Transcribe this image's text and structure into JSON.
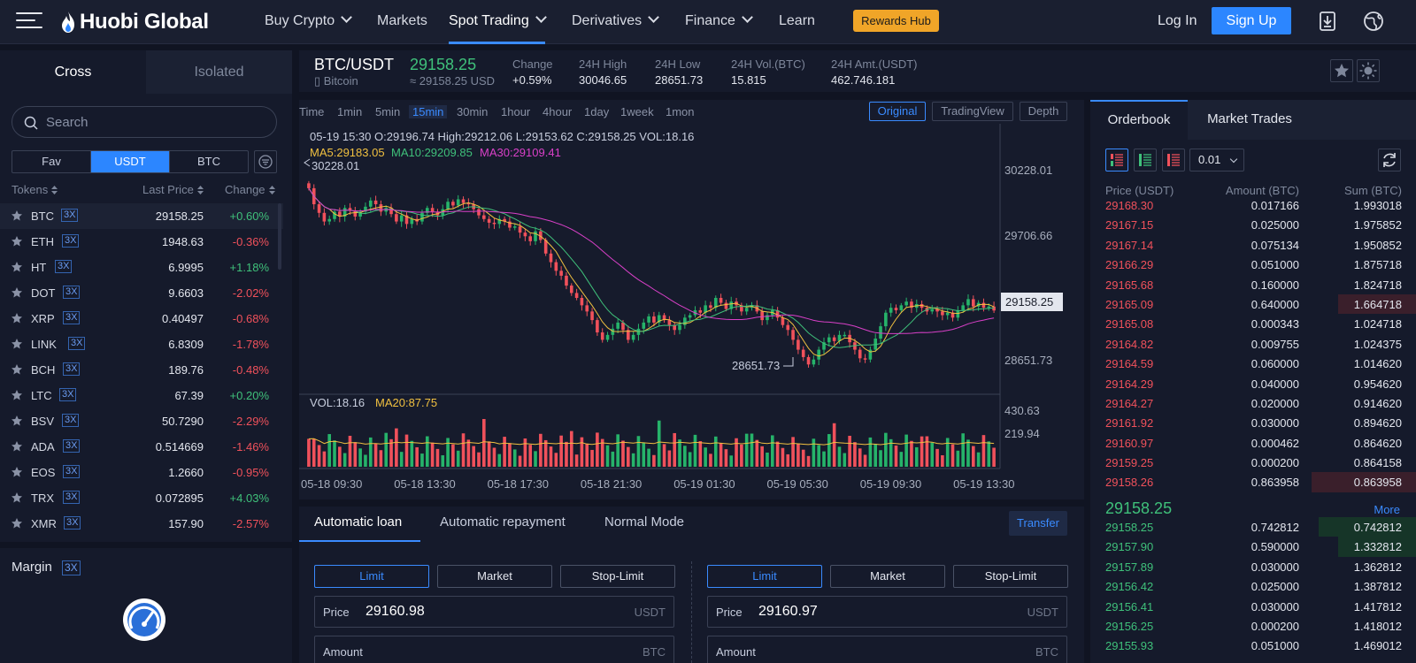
{
  "nav": {
    "logo": "Huobi Global",
    "items": [
      {
        "label": "Buy Crypto",
        "dropdown": true
      },
      {
        "label": "Markets",
        "dropdown": false
      },
      {
        "label": "Spot Trading",
        "dropdown": true,
        "active": true
      },
      {
        "label": "Derivatives",
        "dropdown": true
      },
      {
        "label": "Finance",
        "dropdown": true
      },
      {
        "label": "Learn",
        "dropdown": false
      }
    ],
    "rewards": "Rewards Hub",
    "login": "Log In",
    "signup": "Sign Up",
    "icons": [
      "download-icon",
      "globe-icon"
    ]
  },
  "left": {
    "tabs": [
      "Cross",
      "Isolated"
    ],
    "search_placeholder": "Search",
    "quote_tabs": [
      "Fav",
      "USDT",
      "BTC"
    ],
    "quote_active": "USDT",
    "headers": {
      "tokens": "Tokens",
      "last_price": "Last Price",
      "change": "Change"
    },
    "tokens": [
      {
        "sym": "BTC",
        "lev": "3X",
        "price": "29158.25",
        "chg": "+0.60%",
        "dir": "up"
      },
      {
        "sym": "ETH",
        "lev": "3X",
        "price": "1948.63",
        "chg": "-0.36%",
        "dir": "down"
      },
      {
        "sym": "HT",
        "lev": "3X",
        "price": "6.9995",
        "chg": "+1.18%",
        "dir": "up"
      },
      {
        "sym": "DOT",
        "lev": "3X",
        "price": "9.6603",
        "chg": "-2.02%",
        "dir": "down"
      },
      {
        "sym": "XRP",
        "lev": "3X",
        "price": "0.40497",
        "chg": "-0.68%",
        "dir": "down"
      },
      {
        "sym": "LINK",
        "lev": "3X",
        "price": "6.8309",
        "chg": "-1.78%",
        "dir": "down"
      },
      {
        "sym": "BCH",
        "lev": "3X",
        "price": "189.76",
        "chg": "-0.48%",
        "dir": "down"
      },
      {
        "sym": "LTC",
        "lev": "3X",
        "price": "67.39",
        "chg": "+0.20%",
        "dir": "up"
      },
      {
        "sym": "BSV",
        "lev": "3X",
        "price": "50.7290",
        "chg": "-2.29%",
        "dir": "down"
      },
      {
        "sym": "ADA",
        "lev": "3X",
        "price": "0.514669",
        "chg": "-1.46%",
        "dir": "down"
      },
      {
        "sym": "EOS",
        "lev": "3X",
        "price": "1.2660",
        "chg": "-0.95%",
        "dir": "down"
      },
      {
        "sym": "TRX",
        "lev": "3X",
        "price": "0.072895",
        "chg": "+4.03%",
        "dir": "up"
      },
      {
        "sym": "XMR",
        "lev": "3X",
        "price": "157.90",
        "chg": "-2.57%",
        "dir": "down"
      }
    ],
    "margin_label": "Margin",
    "margin_lev": "3X"
  },
  "ticker": {
    "pair": "BTC/USDT",
    "name": "Bitcoin",
    "last": "29158.25",
    "last_usd": "≈ 29158.25 USD",
    "stats": [
      {
        "label": "Change",
        "value": "+0.59%",
        "dir": "up"
      },
      {
        "label": "24H High",
        "value": "30046.65"
      },
      {
        "label": "24H Low",
        "value": "28651.73"
      },
      {
        "label": "24H Vol.(BTC)",
        "value": "15.815"
      },
      {
        "label": "24H Amt.(USDT)",
        "value": "462.746.181"
      }
    ]
  },
  "chart_toolbar": {
    "timeframes": [
      "Time",
      "1min",
      "5min",
      "15min",
      "30min",
      "1hour",
      "4hour",
      "1day",
      "1week",
      "1mon"
    ],
    "active": "15min",
    "views": [
      "Original",
      "TradingView",
      "Depth"
    ],
    "active_view": "Original"
  },
  "chart_data": {
    "type": "candlestick",
    "info_line": "05-19 15:30   O:29196.74  High:29212.06  L:29153.62  C:29158.25  VOL:18.16",
    "ma_labels": [
      {
        "text": "MA5:29183.05",
        "color": "#f0c040"
      },
      {
        "text": "MA10:29209.85",
        "color": "#3fc07a"
      },
      {
        "text": "MA30:29109.41",
        "color": "#d940c8"
      }
    ],
    "high_marker": "30228.01",
    "low_marker": "28651.73",
    "price_ticks": [
      "30228.01",
      "29706.66",
      "28651.73"
    ],
    "last_price_tag": "29158.25",
    "ylim": [
      28550,
      30300
    ],
    "vol_label": "VOL:18.16",
    "vol_ma_label": "MA20:87.75",
    "vol_ticks": [
      "430.63",
      "219.94"
    ],
    "x_labels": [
      "05-18 09:30",
      "05-18 13:30",
      "05-18 17:30",
      "05-18 21:30",
      "05-19 01:30",
      "05-19 05:30",
      "05-19 09:30",
      "05-19 13:30"
    ],
    "colors": {
      "up": "#26b36a",
      "down": "#f0515b",
      "ma5": "#f0c040",
      "ma10": "#3fc07a",
      "ma30": "#d940c8"
    },
    "closes": [
      30150,
      30020,
      29950,
      29880,
      29900,
      29960,
      29920,
      29990,
      29970,
      29920,
      29960,
      30000,
      30050,
      30020,
      29960,
      29990,
      29940,
      29880,
      29930,
      29860,
      29900,
      29880,
      29950,
      29990,
      29960,
      29930,
      29980,
      30040,
      30010,
      30060,
      30030,
      30020,
      29980,
      29930,
      29900,
      29870,
      29860,
      29900,
      29880,
      29830,
      29840,
      29790,
      29760,
      29720,
      29800,
      29730,
      29620,
      29550,
      29480,
      29440,
      29360,
      29300,
      29260,
      29200,
      29150,
      29080,
      28980,
      28920,
      28960,
      29010,
      29060,
      29000,
      28920,
      28960,
      29010,
      29060,
      29110,
      29060,
      29120,
      29080,
      29040,
      29000,
      29040,
      29100,
      29120,
      29160,
      29140,
      29200,
      29180,
      29260,
      29220,
      29170,
      29230,
      29200,
      29150,
      29180,
      29200,
      29150,
      29080,
      29120,
      29160,
      29100,
      29040,
      29000,
      28920,
      28840,
      28780,
      28720,
      28760,
      28840,
      28900,
      28940,
      28910,
      28960,
      28960,
      28900,
      28840,
      28770,
      28760,
      28840,
      28930,
      29030,
      29140,
      29180,
      29160,
      29200,
      29230,
      29180,
      29210,
      29180,
      29150,
      29170,
      29150,
      29120,
      29140,
      29100,
      29160,
      29200,
      29250,
      29190,
      29220,
      29180,
      29190,
      29158
    ]
  },
  "trade": {
    "tabs": [
      "Automatic loan",
      "Automatic repayment",
      "Normal Mode"
    ],
    "active": "Automatic loan",
    "transfer": "Transfer",
    "order_types": [
      "Limit",
      "Market",
      "Stop-Limit"
    ],
    "active_type": "Limit",
    "buy": {
      "price_label": "Price",
      "price": "29160.98",
      "price_unit": "USDT",
      "amount_label": "Amount",
      "amount_unit": "BTC"
    },
    "sell": {
      "price_label": "Price",
      "price": "29160.97",
      "price_unit": "USDT",
      "amount_label": "Amount",
      "amount_unit": "BTC"
    }
  },
  "orderbook": {
    "tabs": [
      "Orderbook",
      "Market Trades"
    ],
    "precision": "0.01",
    "headers": {
      "price": "Price (USDT)",
      "amount": "Amount (BTC)",
      "sum": "Sum (BTC)"
    },
    "asks": [
      {
        "p": "29168.30",
        "a": "0.017166",
        "s": "1.993018",
        "d": 0
      },
      {
        "p": "29167.15",
        "a": "0.025000",
        "s": "1.975852",
        "d": 0
      },
      {
        "p": "29167.14",
        "a": "0.075134",
        "s": "1.950852",
        "d": 0
      },
      {
        "p": "29166.29",
        "a": "0.051000",
        "s": "1.875718",
        "d": 0
      },
      {
        "p": "29165.68",
        "a": "0.160000",
        "s": "1.824718",
        "d": 0
      },
      {
        "p": "29165.09",
        "a": "0.640000",
        "s": "1.664718",
        "d": 0.24
      },
      {
        "p": "29165.08",
        "a": "0.000343",
        "s": "1.024718",
        "d": 0
      },
      {
        "p": "29164.82",
        "a": "0.009755",
        "s": "1.024375",
        "d": 0
      },
      {
        "p": "29164.59",
        "a": "0.060000",
        "s": "1.014620",
        "d": 0
      },
      {
        "p": "29164.29",
        "a": "0.040000",
        "s": "0.954620",
        "d": 0
      },
      {
        "p": "29164.27",
        "a": "0.020000",
        "s": "0.914620",
        "d": 0
      },
      {
        "p": "29161.92",
        "a": "0.030000",
        "s": "0.894620",
        "d": 0
      },
      {
        "p": "29160.97",
        "a": "0.000462",
        "s": "0.864620",
        "d": 0
      },
      {
        "p": "29159.25",
        "a": "0.000200",
        "s": "0.864158",
        "d": 0
      },
      {
        "p": "29158.26",
        "a": "0.863958",
        "s": "0.863958",
        "d": 0.32
      }
    ],
    "mid_price": "29158.25",
    "more": "More",
    "bids": [
      {
        "p": "29158.25",
        "a": "0.742812",
        "s": "0.742812",
        "d": 0.3
      },
      {
        "p": "29157.90",
        "a": "0.590000",
        "s": "1.332812",
        "d": 0.24
      },
      {
        "p": "29157.89",
        "a": "0.030000",
        "s": "1.362812",
        "d": 0
      },
      {
        "p": "29156.42",
        "a": "0.025000",
        "s": "1.387812",
        "d": 0
      },
      {
        "p": "29156.41",
        "a": "0.030000",
        "s": "1.417812",
        "d": 0
      },
      {
        "p": "29156.25",
        "a": "0.000200",
        "s": "1.418012",
        "d": 0
      },
      {
        "p": "29155.93",
        "a": "0.051000",
        "s": "1.469012",
        "d": 0
      }
    ]
  }
}
